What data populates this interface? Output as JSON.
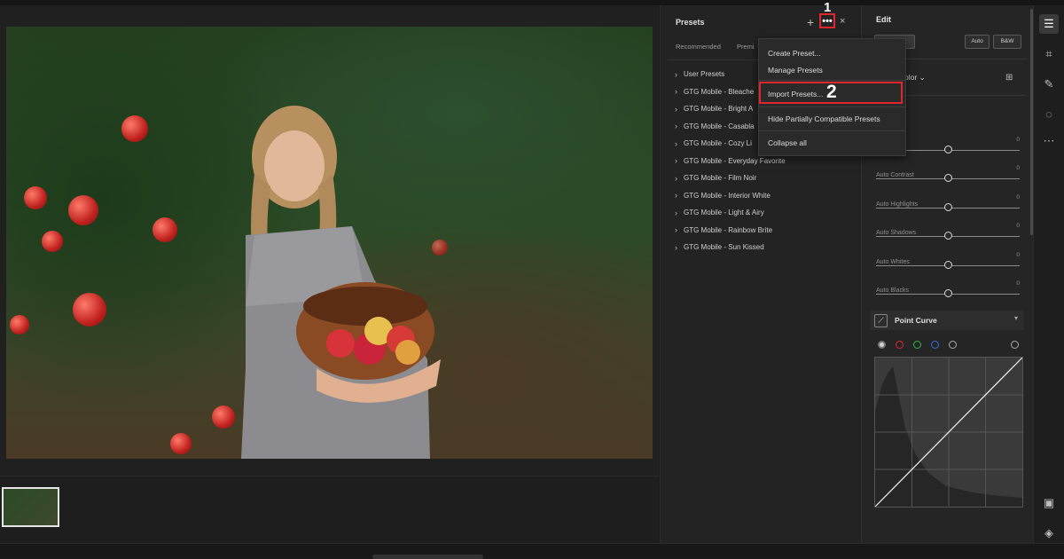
{
  "presets_panel": {
    "title": "Presets",
    "add_icon": "+",
    "more_icon": "•••",
    "close_icon": "×",
    "annotation_1": "1",
    "tabs": [
      "Recommended",
      "Premi"
    ],
    "items": [
      "User Presets",
      "GTG Mobile - Bleache",
      "GTG Mobile - Bright A",
      "GTG Mobile - Casabla",
      "GTG Mobile - Cozy Li",
      "GTG Mobile - Everyday Favorite",
      "GTG Mobile - Film Noir",
      "GTG Mobile - Interior White",
      "GTG Mobile - Light & Airy",
      "GTG Mobile - Rainbow Brite",
      "GTG Mobile - Sun Kissed"
    ]
  },
  "preset_menu": {
    "items": [
      "Create Preset...",
      "Manage Presets",
      "Import Presets...",
      "Hide Partially Compatible Presets",
      "Collapse all"
    ],
    "annotation_2": "2"
  },
  "edit_panel": {
    "title": "Edit",
    "profile_button": "ts",
    "auto_button": "Auto",
    "bw_button": "B&W",
    "color_label": "olor",
    "sliders": [
      {
        "label": "osure",
        "value": "0"
      },
      {
        "label": "Auto Contrast",
        "value": "0"
      },
      {
        "label": "Auto Highlights",
        "value": "0"
      },
      {
        "label": "Auto Shadows",
        "value": "0"
      },
      {
        "label": "Auto Whites",
        "value": "0"
      },
      {
        "label": "Auto Blacks",
        "value": "0"
      }
    ],
    "point_curve_title": "Point Curve"
  },
  "colors": {
    "annotation_red": "#e0262e",
    "panel_bg": "#232323",
    "red_channel": "#e0262e",
    "green_channel": "#2fb84a",
    "blue_channel": "#2f6ee0"
  }
}
